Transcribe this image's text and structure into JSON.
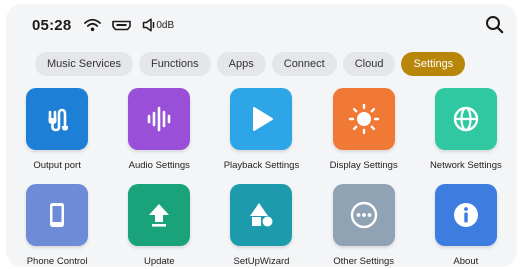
{
  "status_bar": {
    "time": "05:28",
    "volume_label": "0dB",
    "icons": [
      "wifi-icon",
      "hdmi-icon",
      "speaker-icon"
    ]
  },
  "search_icon": "search-icon",
  "tabs": [
    {
      "label": "Music Services",
      "active": false
    },
    {
      "label": "Functions",
      "active": false
    },
    {
      "label": "Apps",
      "active": false
    },
    {
      "label": "Connect",
      "active": false
    },
    {
      "label": "Cloud",
      "active": false
    },
    {
      "label": "Settings",
      "active": true
    }
  ],
  "colors": {
    "active_tab": "#b8860b",
    "output_port": "#1e7fd6",
    "audio_settings": "#9a4fd8",
    "playback_settings": "#2ea5e6",
    "display_settings": "#f07a35",
    "network_settings": "#2fc8a0",
    "phone_control": "#6d8bd6",
    "update": "#1aa37a",
    "setup_wizard": "#1d9aab",
    "other_settings": "#8fa3b5",
    "about": "#3d7de0"
  },
  "tiles": [
    {
      "label": "Output port",
      "icon": "output-port-icon"
    },
    {
      "label": "Audio Settings",
      "icon": "audio-wave-icon"
    },
    {
      "label": "Playback Settings",
      "icon": "play-icon"
    },
    {
      "label": "Display Settings",
      "icon": "brightness-icon"
    },
    {
      "label": "Network Settings",
      "icon": "globe-icon"
    },
    {
      "label": "Phone Control",
      "icon": "phone-icon"
    },
    {
      "label": "Update",
      "icon": "upload-arrow-icon"
    },
    {
      "label": "SetUpWizard",
      "icon": "shapes-icon"
    },
    {
      "label": "Other Settings",
      "icon": "more-dots-icon"
    },
    {
      "label": "About",
      "icon": "info-icon"
    }
  ]
}
